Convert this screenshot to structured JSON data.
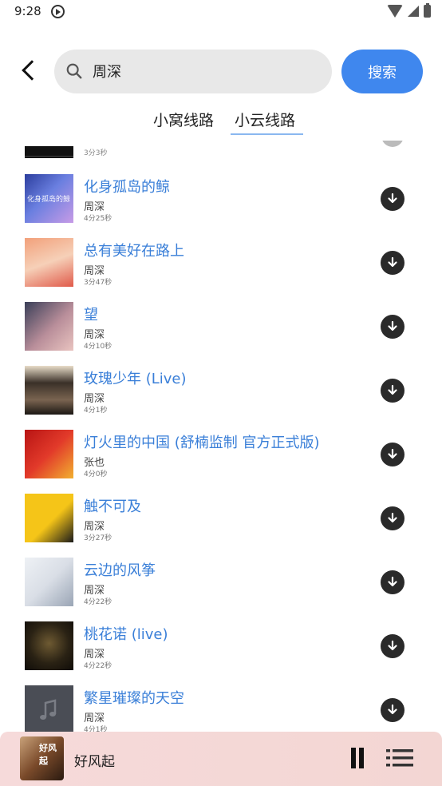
{
  "status_bar": {
    "time": "9:28"
  },
  "search": {
    "query": "周深",
    "placeholder": "",
    "button_label": "搜索"
  },
  "tabs": [
    {
      "label": "小窝线路",
      "active": false
    },
    {
      "label": "小云线路",
      "active": true
    }
  ],
  "partial_item": {
    "duration": "3分3秒"
  },
  "songs": [
    {
      "title": "化身孤岛的鲸",
      "artist": "周深",
      "duration": "4分25秒",
      "cover_caption": "化身孤岛的鲸"
    },
    {
      "title": "总有美好在路上",
      "artist": "周深",
      "duration": "3分47秒",
      "cover_caption": ""
    },
    {
      "title": "望",
      "artist": "周深",
      "duration": "4分10秒",
      "cover_caption": ""
    },
    {
      "title": "玫瑰少年 (Live)",
      "artist": "周深",
      "duration": "4分1秒",
      "cover_caption": ""
    },
    {
      "title": "灯火里的中国 (舒楠监制 官方正式版)",
      "artist": "张也",
      "duration": "4分0秒",
      "cover_caption": ""
    },
    {
      "title": "触不可及",
      "artist": "周深",
      "duration": "3分27秒",
      "cover_caption": ""
    },
    {
      "title": "云边的风筝",
      "artist": "周深",
      "duration": "4分22秒",
      "cover_caption": ""
    },
    {
      "title": "桃花诺 (live)",
      "artist": "周深",
      "duration": "4分22秒",
      "cover_caption": ""
    },
    {
      "title": "繁星璀璨的天空",
      "artist": "周深",
      "duration": "4分1秒",
      "cover_caption": ""
    }
  ],
  "player": {
    "title": "好风起",
    "cover_text": "好风起",
    "state": "playing"
  },
  "colors": {
    "accent": "#3f87ee",
    "song_title": "#3a7fd8",
    "download_button": "#2a2a2a",
    "player_bg": "#f6dada"
  },
  "icons": {
    "back": "chevron-left-icon",
    "search": "search-icon",
    "download": "download-icon",
    "pause": "pause-icon",
    "playlist": "playlist-icon"
  }
}
